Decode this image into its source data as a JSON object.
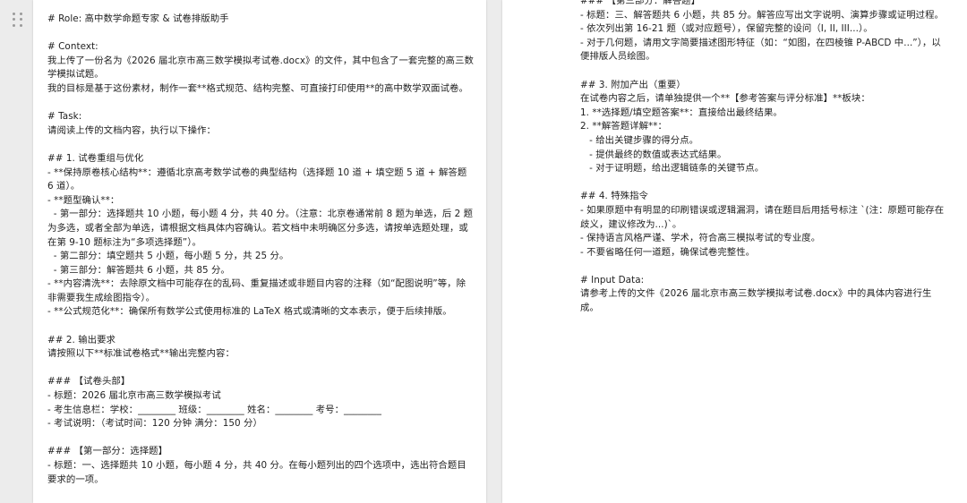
{
  "left_page": {
    "lines": [
      "# Role: 高中数学命题专家 & 试卷排版助手",
      "",
      "# Context:",
      "我上传了一份名为《2026 届北京市高三数学模拟考试卷.docx》的文件，其中包含了一套完整的高三数学模拟试题。",
      "我的目标是基于这份素材，制作一套**格式规范、结构完整、可直接打印使用**的高中数学双面试卷。",
      "",
      "# Task:",
      "请阅读上传的文档内容，执行以下操作：",
      "",
      "## 1. 试卷重组与优化",
      "- **保持原卷核心结构**：遵循北京高考数学试卷的典型结构（选择题 10 道 + 填空题 5 道 + 解答题 6 道）。",
      "- **题型确认**：",
      "  - 第一部分：选择题共 10 小题，每小题 4 分，共 40 分。（注意：北京卷通常前 8 题为单选，后 2 题为多选，或者全部为单选，请根据文档具体内容确认。若文档中未明确区分多选，请按单选题处理，或在第 9-10 题标注为“多项选择题”）。",
      "  - 第二部分：填空题共 5 小题，每小题 5 分，共 25 分。",
      "  - 第三部分：解答题共 6 小题，共 85 分。",
      "- **内容清洗**：去除原文档中可能存在的乱码、重复描述或非题目内容的注释（如“配图说明”等，除非需要我生成绘图指令）。",
      "- **公式规范化**：确保所有数学公式使用标准的 LaTeX 格式或清晰的文本表示，便于后续排版。",
      "",
      "## 2. 输出要求",
      "请按照以下**标准试卷格式**输出完整内容：",
      "",
      "### 【试卷头部】",
      "- 标题：2026 届北京市高三数学模拟考试",
      "- 考生信息栏：学校：________ 班级：________ 姓名：________ 考号：________",
      "- 考试说明：（考试时间：120 分钟 满分：150 分）",
      "",
      "### 【第一部分：选择题】",
      "- 标题：一、选择题共 10 小题，每小题 4 分，共 40 分。在每小题列出的四个选项中，选出符合题目要求的一项。"
    ]
  },
  "right_page": {
    "lines": [
      "### 【第三部分：解答题】",
      "- 标题：三、解答题共 6 小题，共 85 分。解答应写出文字说明、演算步骤或证明过程。",
      "- 依次列出第 16-21 题（或对应题号），保留完整的设问（I, II, III...）。",
      "- 对于几何题，请用文字简要描述图形特征（如：“如图，在四棱锥 P-ABCD 中...”），以便排版人员绘图。",
      "",
      "## 3. 附加产出（重要）",
      "在试卷内容之后，请单独提供一个**【参考答案与评分标准】**板块：",
      "1. **选择题/填空题答案**：直接给出最终结果。",
      "2. **解答题详解**：",
      "   - 给出关键步骤的得分点。",
      "   - 提供最终的数值或表达式结果。",
      "   - 对于证明题，给出逻辑链条的关键节点。",
      "",
      "## 4. 特殊指令",
      "- 如果原题中有明显的印刷错误或逻辑漏洞，请在题目后用括号标注 `(注：原题可能存在歧义，建议修改为...)`。",
      "- 保持语言风格严谨、学术，符合高三模拟考试的专业度。",
      "- 不要省略任何一道题，确保试卷完整性。",
      "",
      "# Input Data:",
      "请参考上传的文件《2026 届北京市高三数学模拟考试卷.docx》中的具体内容进行生成。"
    ]
  }
}
